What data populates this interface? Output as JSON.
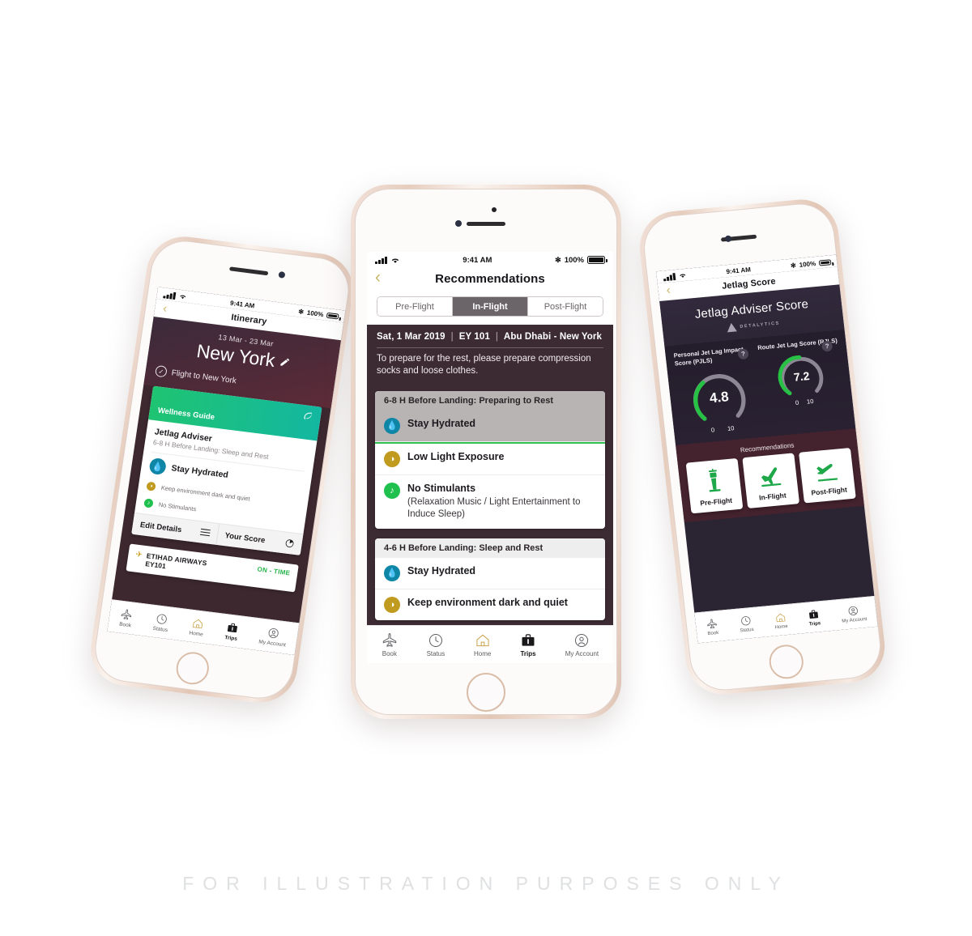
{
  "page": {
    "watermark": "FOR ILLUSTRATION PURPOSES ONLY",
    "background_color": "#ffffff"
  },
  "colors": {
    "brand_gold": "#c9b566",
    "maroon": "#45232e",
    "plum": "#3c2b33",
    "green_accent": "#2fc24e",
    "teal_water": "#0f86a6",
    "gold_light": "#c09b1f",
    "green_music": "#1fc04e",
    "dark_purple": "#2b2433"
  },
  "status_bar": {
    "signal_icon": "cellular-signal-icon",
    "wifi_icon": "wifi-icon",
    "time": "9:41 AM",
    "bluetooth_icon": "bluetooth-icon",
    "battery_percent": "100%",
    "battery_icon": "battery-full-icon"
  },
  "tab_bar": {
    "items": [
      {
        "label": "Book",
        "icon": "airplane-icon",
        "active": false
      },
      {
        "label": "Status",
        "icon": "clock-icon",
        "active": false
      },
      {
        "label": "Home",
        "icon": "home-icon",
        "active": false
      },
      {
        "label": "Trips",
        "icon": "suitcase-icon",
        "active": true
      },
      {
        "label": "My Account",
        "icon": "user-circle-icon",
        "active": false
      }
    ]
  },
  "left_phone": {
    "nav": {
      "back_icon": "chevron-left-icon",
      "title": "Itinerary"
    },
    "hero": {
      "dates": "13 Mar - 23 Mar",
      "city": "New York",
      "edit_icon": "pencil-edit-icon",
      "flight_label": "Flight to New York",
      "check_icon": "check-circle-icon"
    },
    "wellness_card": {
      "header_label": "Wellness Guide",
      "leaf_icon": "leaf-icon",
      "title": "Jetlag Adviser",
      "subtitle": "6-8 H Before Landing: Sleep and Rest",
      "items": [
        {
          "label": "Stay Hydrated",
          "icon": "water-drop-icon",
          "color": "#0f86a6",
          "emphasis": true
        },
        {
          "label": "Keep environment dark and quiet",
          "icon": "half-moon-icon",
          "color": "#c09b1f",
          "emphasis": false
        },
        {
          "label": "No Stimulants",
          "icon": "music-note-icon",
          "color": "#1fc04e",
          "emphasis": false
        }
      ],
      "footer": {
        "edit_details_label": "Edit Details",
        "edit_details_icon": "list-lines-icon",
        "your_score_label": "Your Score",
        "your_score_icon": "pie-chart-icon"
      }
    },
    "flight_card": {
      "logo_icon": "etihad-logo-icon",
      "airline": "ETIHAD AIRWAYS",
      "flight_number": "EY101",
      "status": "ON - TIME"
    }
  },
  "center_phone": {
    "nav": {
      "back_icon": "chevron-left-icon",
      "title": "Recommendations"
    },
    "segmented_control": {
      "options": [
        "Pre-Flight",
        "In-Flight",
        "Post-Flight"
      ],
      "selected": "In-Flight"
    },
    "flight_bar": {
      "date": "Sat, 1 Mar 2019",
      "flight_number": "EY 101",
      "route": "Abu Dhabi - New York",
      "description": "To prepare for the rest, please prepare compression socks and loose clothes."
    },
    "cards": [
      {
        "header": "6-8 H Before Landing: Preparing to Rest",
        "header_style": "dark",
        "rows": [
          {
            "title": "Stay Hydrated",
            "subtitle": "",
            "icon": "water-drop-icon",
            "color": "#0f86a6",
            "dimmed": true
          },
          {
            "title": "Low Light Exposure",
            "subtitle": "",
            "icon": "half-moon-icon",
            "color": "#c09b1f",
            "dimmed": false
          },
          {
            "title": "No Stimulants",
            "subtitle": "(Relaxation Music / Light Entertainment to Induce Sleep)",
            "icon": "music-note-icon",
            "color": "#1fc04e",
            "dimmed": false
          }
        ]
      },
      {
        "header": "4-6 H Before Landing: Sleep and Rest",
        "header_style": "light",
        "rows": [
          {
            "title": "Stay Hydrated",
            "subtitle": "",
            "icon": "water-drop-icon",
            "color": "#0f86a6",
            "dimmed": false
          },
          {
            "title": "Keep environment dark and quiet",
            "subtitle": "",
            "icon": "half-moon-icon",
            "color": "#c09b1f",
            "dimmed": false
          }
        ]
      }
    ]
  },
  "right_phone": {
    "nav": {
      "back_icon": "chevron-left-icon",
      "title": "Jetlag Score"
    },
    "hero": {
      "title": "Jetlag Adviser Score",
      "brand_icon": "detalytics-triangle-icon",
      "brand_name": "DETALYTICS"
    },
    "recommendations_label": "Recommendations",
    "recommendation_buttons": [
      {
        "label": "Pre-Flight",
        "icon": "control-tower-icon"
      },
      {
        "label": "In-Flight",
        "icon": "airplane-cruise-icon"
      },
      {
        "label": "Post-Flight",
        "icon": "airplane-landing-icon"
      }
    ]
  },
  "chart_data": [
    {
      "type": "gauge",
      "title": "Personal Jet Lag Impact Score (PJLS)",
      "value": 4.8,
      "min": 0,
      "max": 10,
      "min_label": "0",
      "max_label": "10",
      "arc_color": "#27c245",
      "track_color": "#8d8795",
      "help_icon": "question-mark-icon"
    },
    {
      "type": "gauge",
      "title": "Route Jet Lag Score (RJLS)",
      "value": 7.2,
      "min": 0,
      "max": 10,
      "min_label": "0",
      "max_label": "10",
      "arc_color": "#27c245",
      "track_color": "#8d8795",
      "help_icon": "question-mark-icon"
    }
  ]
}
